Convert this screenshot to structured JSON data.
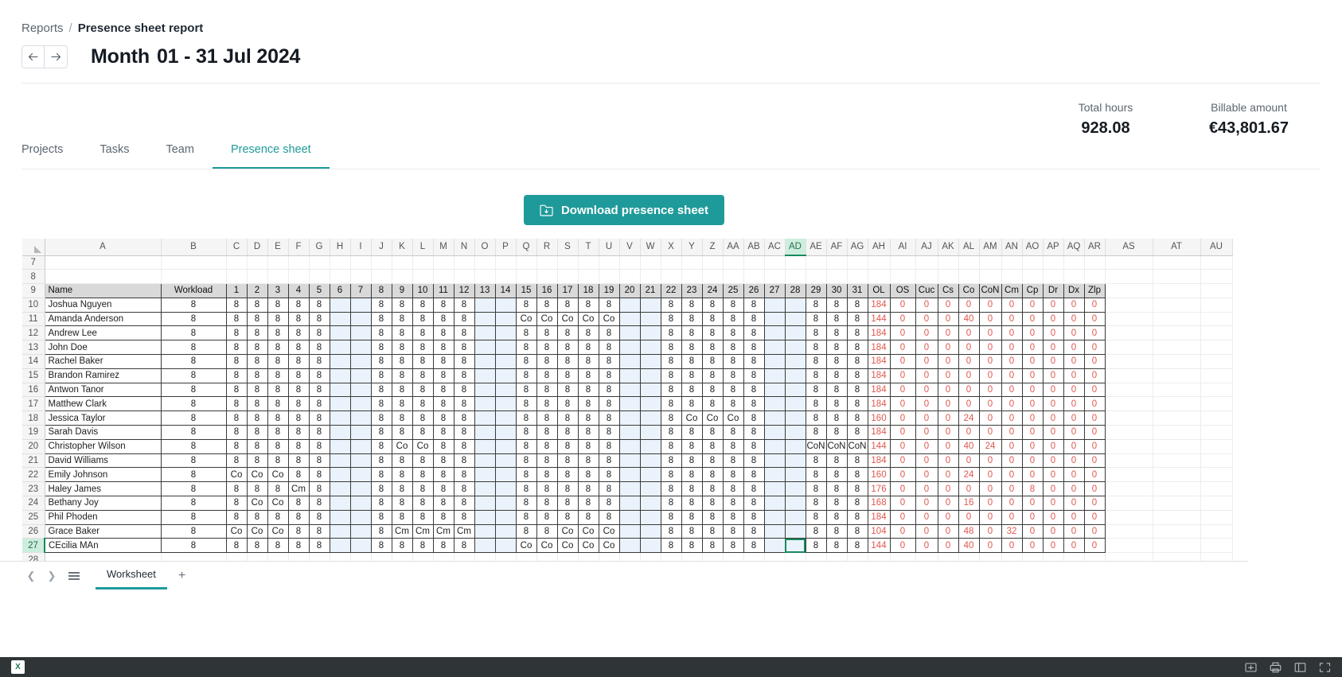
{
  "breadcrumb": {
    "parent": "Reports",
    "separator": "/",
    "current": "Presence sheet report"
  },
  "header": {
    "prev_icon": "arrow-left-icon",
    "next_icon": "arrow-right-icon",
    "title_prefix": "Month",
    "title_range": "01 - 31 Jul 2024"
  },
  "stats": [
    {
      "label": "Total hours",
      "value": "928.08"
    },
    {
      "label": "Billable amount",
      "value": "€43,801.67"
    }
  ],
  "tabs": [
    {
      "label": "Projects",
      "active": false
    },
    {
      "label": "Tasks",
      "active": false
    },
    {
      "label": "Team",
      "active": false
    },
    {
      "label": "Presence sheet",
      "active": true
    }
  ],
  "download_button": {
    "label": "Download presence sheet",
    "icon": "download-sheet-icon",
    "color": "#1f9a9a"
  },
  "spreadsheet": {
    "selected_column": "AD",
    "selected_row": "27",
    "selected_cell": "AD27",
    "column_letters": [
      "A",
      "B",
      "C",
      "D",
      "E",
      "F",
      "G",
      "H",
      "I",
      "J",
      "K",
      "L",
      "M",
      "N",
      "O",
      "P",
      "Q",
      "R",
      "S",
      "T",
      "U",
      "V",
      "W",
      "X",
      "Y",
      "Z",
      "AA",
      "AB",
      "AC",
      "AD",
      "AE",
      "AF",
      "AG",
      "AH",
      "AI",
      "AJ",
      "AK",
      "AL",
      "AM",
      "AN",
      "AO",
      "AP",
      "AQ",
      "AR",
      "AS",
      "AT",
      "AU"
    ],
    "row_numbers": [
      "7",
      "8",
      "9",
      "10",
      "11",
      "12",
      "13",
      "14",
      "15",
      "16",
      "17",
      "18",
      "19",
      "20",
      "21",
      "22",
      "23",
      "24",
      "25",
      "26",
      "27",
      "28"
    ],
    "header_row": [
      "Name",
      "Workload",
      "1",
      "2",
      "3",
      "4",
      "5",
      "6",
      "7",
      "8",
      "9",
      "10",
      "11",
      "12",
      "13",
      "14",
      "15",
      "16",
      "17",
      "18",
      "19",
      "20",
      "21",
      "22",
      "23",
      "24",
      "25",
      "26",
      "27",
      "28",
      "29",
      "30",
      "31",
      "OL",
      "OS",
      "Cuc",
      "Cs",
      "Co",
      "CoN",
      "Cm",
      "Cp",
      "Dr",
      "Dx",
      "Zlp"
    ],
    "weekend_day_indexes": [
      6,
      7,
      13,
      14,
      20,
      21,
      27,
      28
    ],
    "rows": [
      {
        "row": "10",
        "name": "Joshua Nguyen",
        "workload": "8",
        "days": [
          "8",
          "8",
          "8",
          "8",
          "8",
          "",
          "",
          "8",
          "8",
          "8",
          "8",
          "8",
          "",
          "",
          "8",
          "8",
          "8",
          "8",
          "8",
          "",
          "",
          "8",
          "8",
          "8",
          "8",
          "8",
          "",
          "",
          "8",
          "8",
          "8"
        ],
        "totals": [
          "184",
          "0",
          "0",
          "0",
          "0",
          "0",
          "0",
          "0",
          "0",
          "0",
          "0"
        ]
      },
      {
        "row": "11",
        "name": "Amanda Anderson",
        "workload": "8",
        "days": [
          "8",
          "8",
          "8",
          "8",
          "8",
          "",
          "",
          "8",
          "8",
          "8",
          "8",
          "8",
          "",
          "",
          "Co",
          "Co",
          "Co",
          "Co",
          "Co",
          "",
          "",
          "8",
          "8",
          "8",
          "8",
          "8",
          "",
          "",
          "8",
          "8",
          "8"
        ],
        "totals": [
          "144",
          "0",
          "0",
          "0",
          "40",
          "0",
          "0",
          "0",
          "0",
          "0",
          "0"
        ]
      },
      {
        "row": "12",
        "name": "Andrew Lee",
        "workload": "8",
        "days": [
          "8",
          "8",
          "8",
          "8",
          "8",
          "",
          "",
          "8",
          "8",
          "8",
          "8",
          "8",
          "",
          "",
          "8",
          "8",
          "8",
          "8",
          "8",
          "",
          "",
          "8",
          "8",
          "8",
          "8",
          "8",
          "",
          "",
          "8",
          "8",
          "8"
        ],
        "totals": [
          "184",
          "0",
          "0",
          "0",
          "0",
          "0",
          "0",
          "0",
          "0",
          "0",
          "0"
        ]
      },
      {
        "row": "13",
        "name": "John Doe",
        "workload": "8",
        "days": [
          "8",
          "8",
          "8",
          "8",
          "8",
          "",
          "",
          "8",
          "8",
          "8",
          "8",
          "8",
          "",
          "",
          "8",
          "8",
          "8",
          "8",
          "8",
          "",
          "",
          "8",
          "8",
          "8",
          "8",
          "8",
          "",
          "",
          "8",
          "8",
          "8"
        ],
        "totals": [
          "184",
          "0",
          "0",
          "0",
          "0",
          "0",
          "0",
          "0",
          "0",
          "0",
          "0"
        ]
      },
      {
        "row": "14",
        "name": "Rachel Baker",
        "workload": "8",
        "days": [
          "8",
          "8",
          "8",
          "8",
          "8",
          "",
          "",
          "8",
          "8",
          "8",
          "8",
          "8",
          "",
          "",
          "8",
          "8",
          "8",
          "8",
          "8",
          "",
          "",
          "8",
          "8",
          "8",
          "8",
          "8",
          "",
          "",
          "8",
          "8",
          "8"
        ],
        "totals": [
          "184",
          "0",
          "0",
          "0",
          "0",
          "0",
          "0",
          "0",
          "0",
          "0",
          "0"
        ]
      },
      {
        "row": "15",
        "name": "Brandon Ramirez",
        "workload": "8",
        "days": [
          "8",
          "8",
          "8",
          "8",
          "8",
          "",
          "",
          "8",
          "8",
          "8",
          "8",
          "8",
          "",
          "",
          "8",
          "8",
          "8",
          "8",
          "8",
          "",
          "",
          "8",
          "8",
          "8",
          "8",
          "8",
          "",
          "",
          "8",
          "8",
          "8"
        ],
        "totals": [
          "184",
          "0",
          "0",
          "0",
          "0",
          "0",
          "0",
          "0",
          "0",
          "0",
          "0"
        ]
      },
      {
        "row": "16",
        "name": "Antwon Tanor",
        "workload": "8",
        "days": [
          "8",
          "8",
          "8",
          "8",
          "8",
          "",
          "",
          "8",
          "8",
          "8",
          "8",
          "8",
          "",
          "",
          "8",
          "8",
          "8",
          "8",
          "8",
          "",
          "",
          "8",
          "8",
          "8",
          "8",
          "8",
          "",
          "",
          "8",
          "8",
          "8"
        ],
        "totals": [
          "184",
          "0",
          "0",
          "0",
          "0",
          "0",
          "0",
          "0",
          "0",
          "0",
          "0"
        ]
      },
      {
        "row": "17",
        "name": "Matthew Clark",
        "workload": "8",
        "days": [
          "8",
          "8",
          "8",
          "8",
          "8",
          "",
          "",
          "8",
          "8",
          "8",
          "8",
          "8",
          "",
          "",
          "8",
          "8",
          "8",
          "8",
          "8",
          "",
          "",
          "8",
          "8",
          "8",
          "8",
          "8",
          "",
          "",
          "8",
          "8",
          "8"
        ],
        "totals": [
          "184",
          "0",
          "0",
          "0",
          "0",
          "0",
          "0",
          "0",
          "0",
          "0",
          "0"
        ]
      },
      {
        "row": "18",
        "name": "Jessica Taylor",
        "workload": "8",
        "days": [
          "8",
          "8",
          "8",
          "8",
          "8",
          "",
          "",
          "8",
          "8",
          "8",
          "8",
          "8",
          "",
          "",
          "8",
          "8",
          "8",
          "8",
          "8",
          "",
          "",
          "8",
          "Co",
          "Co",
          "Co",
          "8",
          "",
          "",
          "8",
          "8",
          "8"
        ],
        "totals": [
          "160",
          "0",
          "0",
          "0",
          "24",
          "0",
          "0",
          "0",
          "0",
          "0",
          "0"
        ]
      },
      {
        "row": "19",
        "name": "Sarah Davis",
        "workload": "8",
        "days": [
          "8",
          "8",
          "8",
          "8",
          "8",
          "",
          "",
          "8",
          "8",
          "8",
          "8",
          "8",
          "",
          "",
          "8",
          "8",
          "8",
          "8",
          "8",
          "",
          "",
          "8",
          "8",
          "8",
          "8",
          "8",
          "",
          "",
          "8",
          "8",
          "8"
        ],
        "totals": [
          "184",
          "0",
          "0",
          "0",
          "0",
          "0",
          "0",
          "0",
          "0",
          "0",
          "0"
        ]
      },
      {
        "row": "20",
        "name": "Christopher Wilson",
        "workload": "8",
        "days": [
          "8",
          "8",
          "8",
          "8",
          "8",
          "",
          "",
          "8",
          "Co",
          "Co",
          "8",
          "8",
          "",
          "",
          "8",
          "8",
          "8",
          "8",
          "8",
          "",
          "",
          "8",
          "8",
          "8",
          "8",
          "8",
          "",
          "",
          "CoN",
          "CoN",
          "CoN"
        ],
        "totals": [
          "144",
          "0",
          "0",
          "0",
          "40",
          "24",
          "0",
          "0",
          "0",
          "0",
          "0"
        ]
      },
      {
        "row": "21",
        "name": "David Williams",
        "workload": "8",
        "days": [
          "8",
          "8",
          "8",
          "8",
          "8",
          "",
          "",
          "8",
          "8",
          "8",
          "8",
          "8",
          "",
          "",
          "8",
          "8",
          "8",
          "8",
          "8",
          "",
          "",
          "8",
          "8",
          "8",
          "8",
          "8",
          "",
          "",
          "8",
          "8",
          "8"
        ],
        "totals": [
          "184",
          "0",
          "0",
          "0",
          "0",
          "0",
          "0",
          "0",
          "0",
          "0",
          "0"
        ]
      },
      {
        "row": "22",
        "name": "Emily Johnson",
        "workload": "8",
        "days": [
          "Co",
          "Co",
          "Co",
          "8",
          "8",
          "",
          "",
          "8",
          "8",
          "8",
          "8",
          "8",
          "",
          "",
          "8",
          "8",
          "8",
          "8",
          "8",
          "",
          "",
          "8",
          "8",
          "8",
          "8",
          "8",
          "",
          "",
          "8",
          "8",
          "8"
        ],
        "totals": [
          "160",
          "0",
          "0",
          "0",
          "24",
          "0",
          "0",
          "0",
          "0",
          "0",
          "0"
        ]
      },
      {
        "row": "23",
        "name": "Haley James",
        "workload": "8",
        "days": [
          "8",
          "8",
          "8",
          "Cm",
          "8",
          "",
          "",
          "8",
          "8",
          "8",
          "8",
          "8",
          "",
          "",
          "8",
          "8",
          "8",
          "8",
          "8",
          "",
          "",
          "8",
          "8",
          "8",
          "8",
          "8",
          "",
          "",
          "8",
          "8",
          "8"
        ],
        "totals": [
          "176",
          "0",
          "0",
          "0",
          "0",
          "0",
          "0",
          "8",
          "0",
          "0",
          "0"
        ]
      },
      {
        "row": "24",
        "name": "Bethany Joy",
        "workload": "8",
        "days": [
          "8",
          "Co",
          "Co",
          "8",
          "8",
          "",
          "",
          "8",
          "8",
          "8",
          "8",
          "8",
          "",
          "",
          "8",
          "8",
          "8",
          "8",
          "8",
          "",
          "",
          "8",
          "8",
          "8",
          "8",
          "8",
          "",
          "",
          "8",
          "8",
          "8"
        ],
        "totals": [
          "168",
          "0",
          "0",
          "0",
          "16",
          "0",
          "0",
          "0",
          "0",
          "0",
          "0"
        ]
      },
      {
        "row": "25",
        "name": "Phil Phoden",
        "workload": "8",
        "days": [
          "8",
          "8",
          "8",
          "8",
          "8",
          "",
          "",
          "8",
          "8",
          "8",
          "8",
          "8",
          "",
          "",
          "8",
          "8",
          "8",
          "8",
          "8",
          "",
          "",
          "8",
          "8",
          "8",
          "8",
          "8",
          "",
          "",
          "8",
          "8",
          "8"
        ],
        "totals": [
          "184",
          "0",
          "0",
          "0",
          "0",
          "0",
          "0",
          "0",
          "0",
          "0",
          "0"
        ]
      },
      {
        "row": "26",
        "name": "Grace Baker",
        "workload": "8",
        "days": [
          "Co",
          "Co",
          "Co",
          "8",
          "8",
          "",
          "",
          "8",
          "Cm",
          "Cm",
          "Cm",
          "Cm",
          "",
          "",
          "8",
          "8",
          "Co",
          "Co",
          "Co",
          "",
          "",
          "8",
          "8",
          "8",
          "8",
          "8",
          "",
          "",
          "8",
          "8",
          "8"
        ],
        "totals": [
          "104",
          "0",
          "0",
          "0",
          "48",
          "0",
          "32",
          "0",
          "0",
          "0",
          "0"
        ]
      },
      {
        "row": "27",
        "name": "CEcilia MAn",
        "workload": "8",
        "days": [
          "8",
          "8",
          "8",
          "8",
          "8",
          "",
          "",
          "8",
          "8",
          "8",
          "8",
          "8",
          "",
          "",
          "Co",
          "Co",
          "Co",
          "Co",
          "Co",
          "",
          "",
          "8",
          "8",
          "8",
          "8",
          "8",
          "",
          "",
          "8",
          "8",
          "8"
        ],
        "totals": [
          "144",
          "0",
          "0",
          "0",
          "40",
          "0",
          "0",
          "0",
          "0",
          "0",
          "0"
        ]
      }
    ]
  },
  "sheet_bar": {
    "prev_icon": "chevron-left-icon",
    "next_icon": "chevron-right-icon",
    "menu_icon": "sheet-list-icon",
    "tab_label": "Worksheet",
    "add_icon": "plus-icon"
  },
  "status_bar": {
    "app_icon": "excel-icon",
    "icons": [
      "save-to-device-icon",
      "print-icon",
      "sidebar-icon",
      "fullscreen-icon"
    ]
  }
}
